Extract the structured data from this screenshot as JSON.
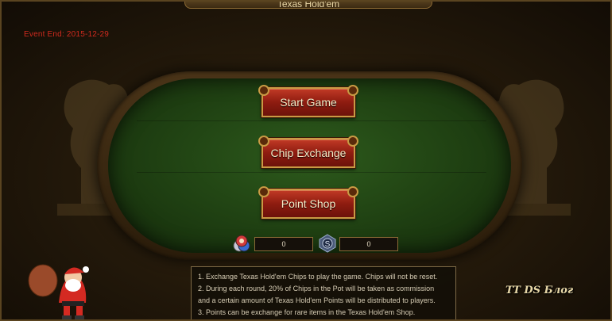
{
  "window": {
    "title": "Texas Hold'em"
  },
  "event": {
    "label": "Event End:",
    "date": "2015-12-29"
  },
  "buttons": {
    "start": "Start Game",
    "exchange": "Chip Exchange",
    "shop": "Point Shop"
  },
  "balances": {
    "chips": "0",
    "points": "0"
  },
  "rules": [
    "1. Exchange Texas Hold'em Chips to play the game. Chips will not be reset.",
    "2. During each round, 20% of Chips in the Pot will be taken as commission",
    "and a certain amount of Texas Hold'em Points will be distributed to players.",
    "3. Points can be exchange for rare items in the Texas Hold'em Shop."
  ],
  "watermark": "TT DS Блог",
  "colors": {
    "felt": "#1f4012",
    "button": "#8e1c10",
    "gold_border": "#c89a44",
    "event_text": "#d02a1e"
  },
  "icons": {
    "chips": "poker-chips-icon",
    "points": "point-coin-icon",
    "mascot": "santa-icon"
  }
}
